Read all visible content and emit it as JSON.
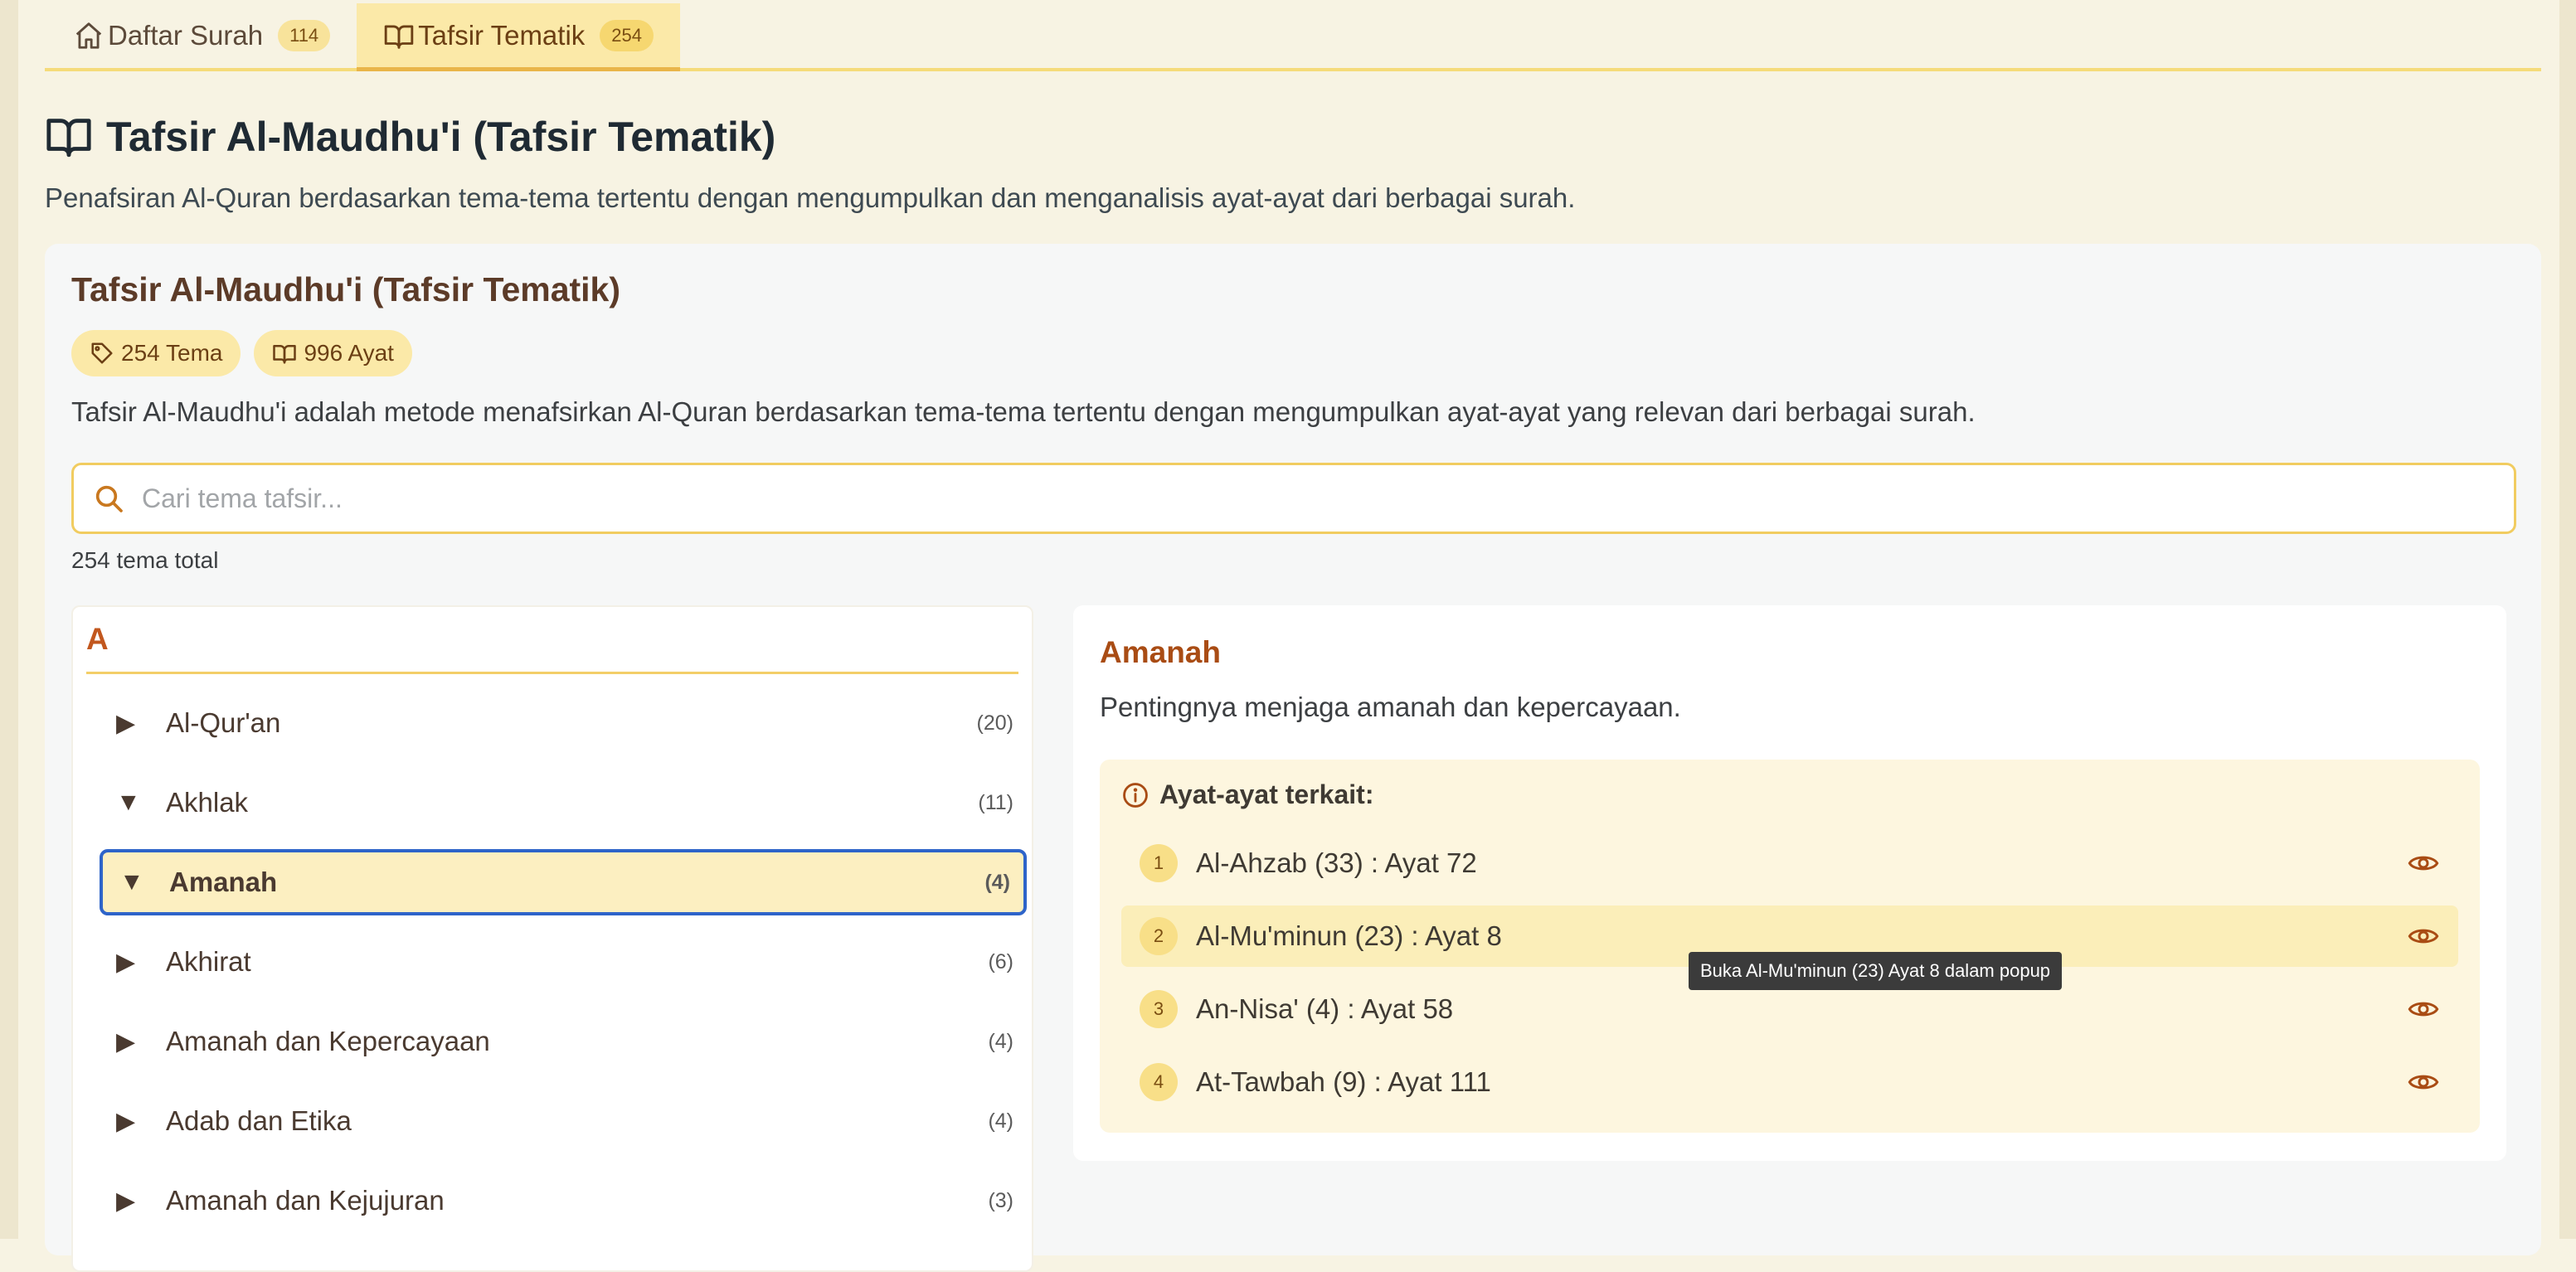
{
  "tabs": [
    {
      "label": "Daftar Surah",
      "badge": "114",
      "icon": "home-icon"
    },
    {
      "label": "Tafsir Tematik",
      "badge": "254",
      "icon": "book-open-icon"
    }
  ],
  "page": {
    "title": "Tafsir Al-Maudhu'i (Tafsir Tematik)",
    "subtitle": "Penafsiran Al-Quran berdasarkan tema-tema tertentu dengan mengumpulkan dan menganalisis ayat-ayat dari berbagai surah."
  },
  "card": {
    "title": "Tafsir Al-Maudhu'i (Tafsir Tematik)",
    "chip_tema": "254 Tema",
    "chip_ayat": "996 Ayat",
    "description": "Tafsir Al-Maudhu'i adalah metode menafsirkan Al-Quran berdasarkan tema-tema tertentu dengan mengumpulkan ayat-ayat yang relevan dari berbagai surah.",
    "search_placeholder": "Cari tema tafsir...",
    "total": "254 tema total"
  },
  "topics": {
    "letter": "A",
    "items": [
      {
        "tri": "▶",
        "name": "Al-Qur'an",
        "count": "(20)"
      },
      {
        "tri": "▼",
        "name": "Akhlak",
        "count": "(11)"
      },
      {
        "tri": "▼",
        "name": "Amanah",
        "count": "(4)"
      },
      {
        "tri": "▶",
        "name": "Akhirat",
        "count": "(6)"
      },
      {
        "tri": "▶",
        "name": "Amanah dan Kepercayaan",
        "count": "(4)"
      },
      {
        "tri": "▶",
        "name": "Adab dan Etika",
        "count": "(4)"
      },
      {
        "tri": "▶",
        "name": "Amanah dan Kejujuran",
        "count": "(3)"
      }
    ]
  },
  "detail": {
    "title": "Amanah",
    "description": "Pentingnya menjaga amanah dan kepercayaan.",
    "verses_heading": "Ayat-ayat terkait:",
    "verses": [
      {
        "num": "1",
        "ref": "Al-Ahzab (33) : Ayat 72"
      },
      {
        "num": "2",
        "ref": "Al-Mu'minun (23) : Ayat 8"
      },
      {
        "num": "3",
        "ref": "An-Nisa' (4) : Ayat 58"
      },
      {
        "num": "4",
        "ref": "At-Tawbah (9) : Ayat 111"
      }
    ],
    "tooltip": "Buka Al-Mu'minun (23) Ayat 8 dalam popup"
  },
  "colors": {
    "accent": "#f6d770",
    "brand_brown": "#a94c14",
    "selection_border": "#2e64c9"
  }
}
